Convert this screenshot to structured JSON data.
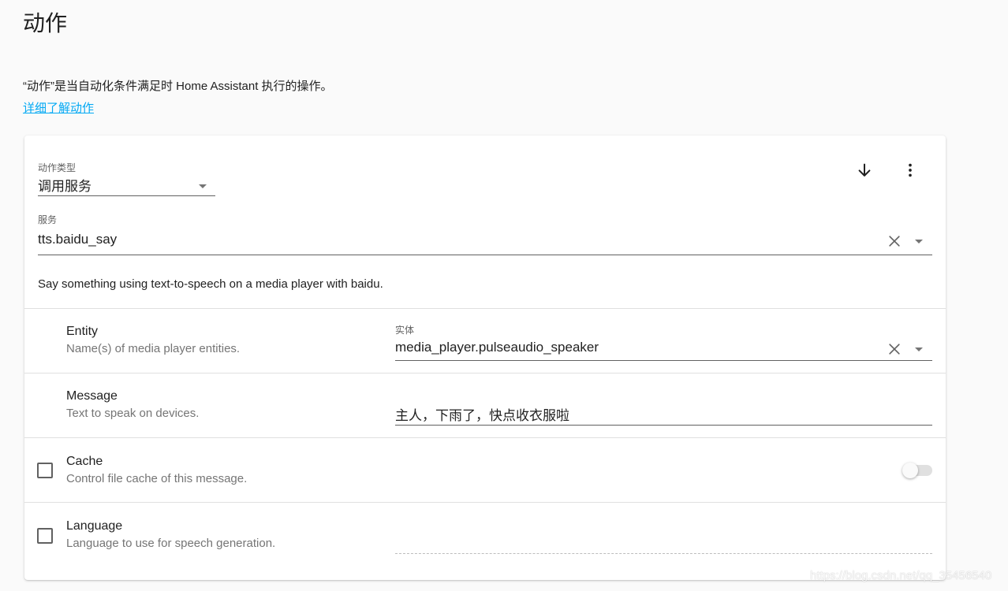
{
  "page": {
    "title": "动作",
    "intro": "“动作”是当自动化条件满足时 Home Assistant 执行的操作。",
    "learn_link": "详细了解动作"
  },
  "action": {
    "type_label": "动作类型",
    "type_value": "调用服务",
    "service_label": "服务",
    "service_value": "tts.baidu_say",
    "service_description": "Say something using text-to-speech on a media player with baidu.",
    "move_down_icon": "arrow-down-icon",
    "menu_icon": "more-vertical-icon"
  },
  "fields": {
    "entity": {
      "title": "Entity",
      "description": "Name(s) of media player entities.",
      "input_label": "实体",
      "value": "media_player.pulseaudio_speaker"
    },
    "message": {
      "title": "Message",
      "description": "Text to speak on devices.",
      "value": "主人，下雨了，快点收衣服啦"
    },
    "cache": {
      "title": "Cache",
      "description": "Control file cache of this message.",
      "enabled": false,
      "toggle_on": false
    },
    "language": {
      "title": "Language",
      "description": "Language to use for speech generation.",
      "enabled": false,
      "value": ""
    }
  },
  "watermark": "https://blog.csdn.net/qq_35456540",
  "colors": {
    "link": "#03a9f4",
    "background": "#fafafa",
    "card": "#ffffff",
    "divider": "#e0e0e0"
  }
}
